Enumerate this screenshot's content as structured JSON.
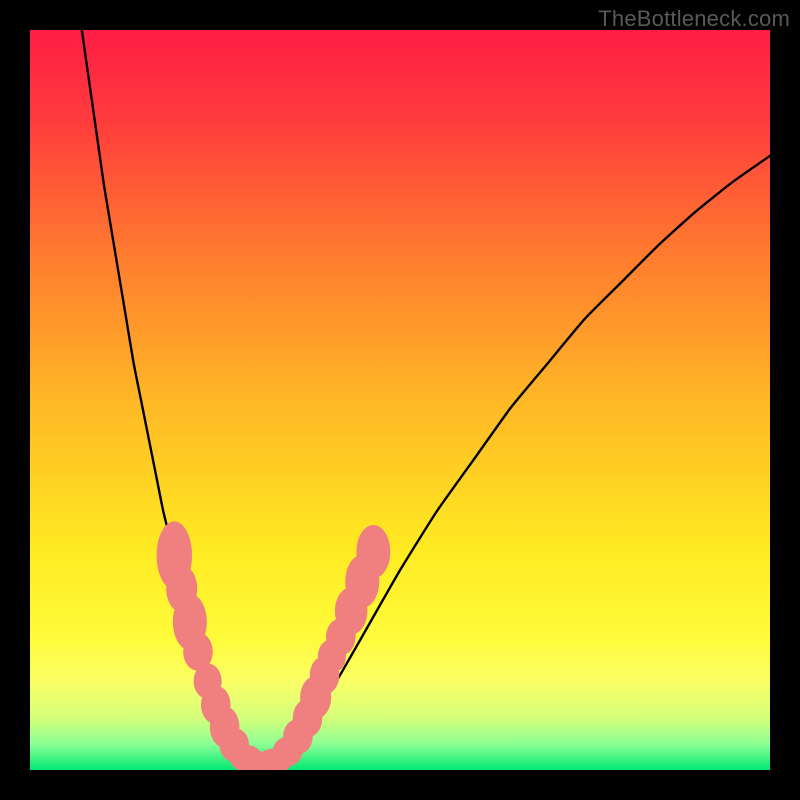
{
  "watermark": "TheBottleneck.com",
  "colors": {
    "frame": "#000000",
    "curve": "#000000",
    "marker_fill": "#f08080",
    "marker_stroke": "rgba(0,0,0,0)",
    "gradient_stops": [
      {
        "offset": 0.0,
        "color": "#ff1d44"
      },
      {
        "offset": 0.12,
        "color": "#ff3b3d"
      },
      {
        "offset": 0.3,
        "color": "#ff7a2f"
      },
      {
        "offset": 0.5,
        "color": "#ffb726"
      },
      {
        "offset": 0.7,
        "color": "#ffea22"
      },
      {
        "offset": 0.82,
        "color": "#fffb3a"
      },
      {
        "offset": 0.88,
        "color": "#fbff66"
      },
      {
        "offset": 0.93,
        "color": "#d4ff7a"
      },
      {
        "offset": 0.965,
        "color": "#8cff94"
      },
      {
        "offset": 1.0,
        "color": "#00e874"
      }
    ]
  },
  "chart_data": {
    "type": "line",
    "title": "",
    "xlabel": "",
    "ylabel": "",
    "xlim": [
      0,
      100
    ],
    "ylim": [
      0,
      100
    ],
    "grid": false,
    "legend": false,
    "series": [
      {
        "name": "curve",
        "x": [
          7,
          8,
          9,
          10,
          11,
          12,
          13,
          14,
          15,
          16,
          17,
          18,
          19,
          20,
          21,
          22,
          23,
          24,
          25,
          26,
          27,
          28,
          29,
          30,
          31,
          33,
          35,
          38,
          42,
          46,
          50,
          55,
          60,
          65,
          70,
          75,
          80,
          85,
          90,
          95,
          100
        ],
        "y": [
          100,
          93,
          86,
          79,
          73,
          67,
          61,
          55,
          50,
          45,
          40,
          35,
          31,
          27,
          23,
          19,
          16,
          13,
          10,
          7,
          5,
          3.5,
          2.2,
          1.3,
          0.9,
          1.1,
          2.8,
          6.5,
          13,
          20,
          27,
          35,
          42,
          49,
          55,
          61,
          66,
          71,
          75.5,
          79.5,
          83
        ]
      }
    ],
    "markers": [
      {
        "x": 19.5,
        "y": 29.0,
        "rx": 2.4,
        "ry": 4.6
      },
      {
        "x": 20.5,
        "y": 24.5,
        "rx": 2.1,
        "ry": 3.2
      },
      {
        "x": 21.6,
        "y": 20.0,
        "rx": 2.3,
        "ry": 3.8
      },
      {
        "x": 22.7,
        "y": 16.0,
        "rx": 2.0,
        "ry": 2.6
      },
      {
        "x": 24.0,
        "y": 12.0,
        "rx": 1.9,
        "ry": 2.4
      },
      {
        "x": 25.1,
        "y": 8.8,
        "rx": 2.0,
        "ry": 2.6
      },
      {
        "x": 26.3,
        "y": 5.8,
        "rx": 2.0,
        "ry": 2.8
      },
      {
        "x": 27.6,
        "y": 3.4,
        "rx": 2.0,
        "ry": 2.3
      },
      {
        "x": 29.2,
        "y": 1.6,
        "rx": 2.2,
        "ry": 1.8
      },
      {
        "x": 31.0,
        "y": 0.9,
        "rx": 2.6,
        "ry": 1.6
      },
      {
        "x": 33.0,
        "y": 1.2,
        "rx": 2.4,
        "ry": 1.7
      },
      {
        "x": 34.8,
        "y": 2.5,
        "rx": 2.0,
        "ry": 2.0
      },
      {
        "x": 36.2,
        "y": 4.5,
        "rx": 2.0,
        "ry": 2.4
      },
      {
        "x": 37.5,
        "y": 7.0,
        "rx": 2.0,
        "ry": 2.6
      },
      {
        "x": 38.6,
        "y": 9.8,
        "rx": 2.1,
        "ry": 2.9
      },
      {
        "x": 39.8,
        "y": 12.8,
        "rx": 2.0,
        "ry": 2.6
      },
      {
        "x": 40.8,
        "y": 15.4,
        "rx": 1.9,
        "ry": 2.3
      },
      {
        "x": 42.0,
        "y": 18.0,
        "rx": 2.0,
        "ry": 2.5
      },
      {
        "x": 43.4,
        "y": 21.5,
        "rx": 2.2,
        "ry": 3.2
      },
      {
        "x": 44.9,
        "y": 25.5,
        "rx": 2.3,
        "ry": 3.6
      },
      {
        "x": 46.4,
        "y": 29.5,
        "rx": 2.3,
        "ry": 3.6
      }
    ]
  }
}
